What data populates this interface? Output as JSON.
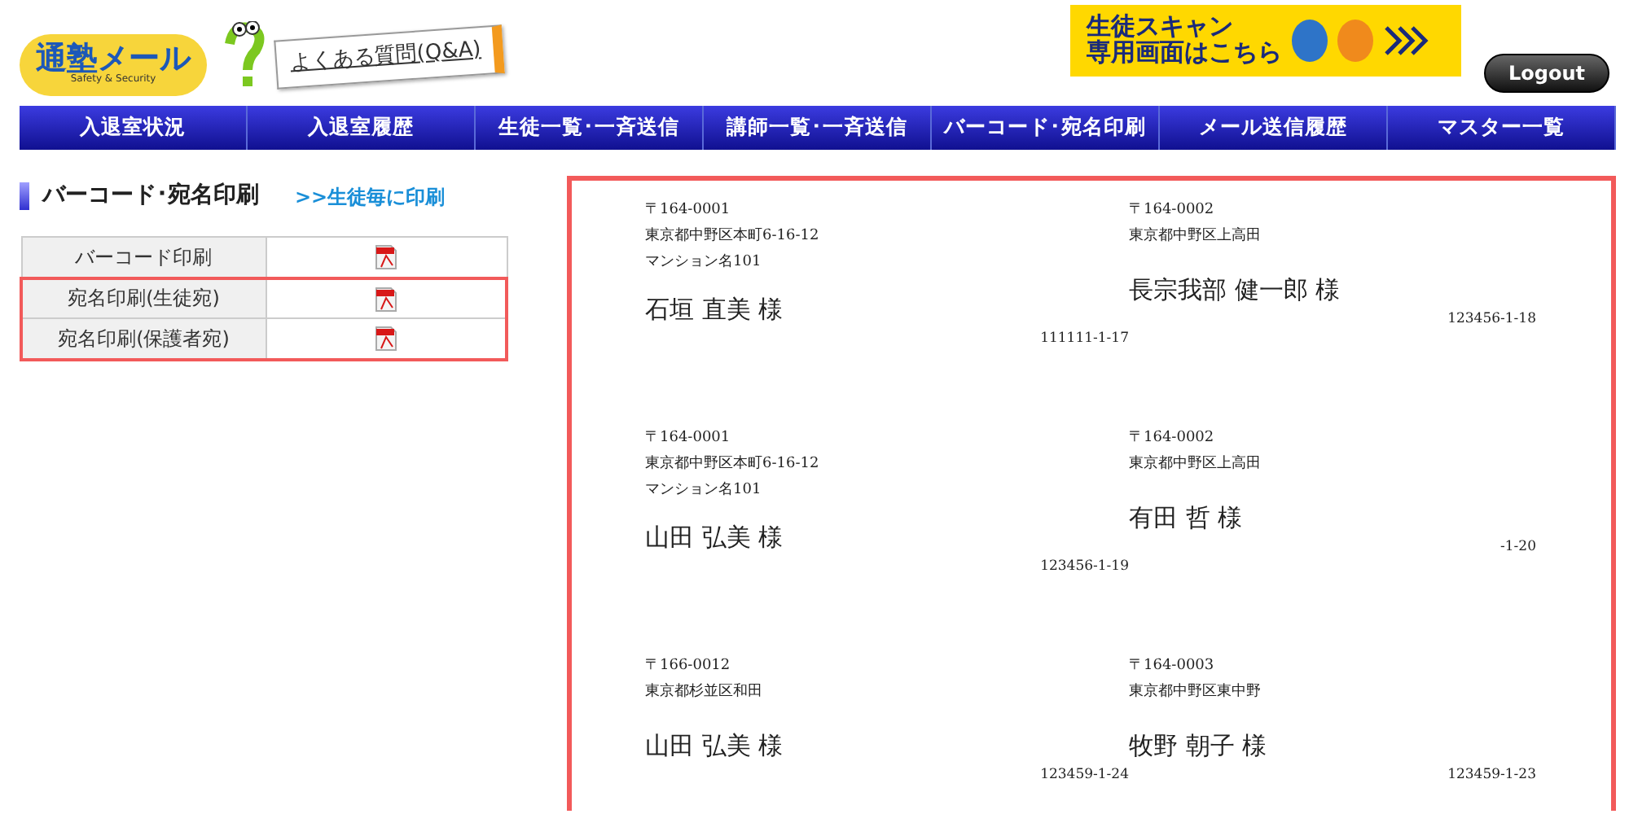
{
  "header": {
    "logo_text": "通塾メール",
    "logo_tagline": "Safety & Security",
    "faq_link": "よくある質問(Q&A)",
    "student_banner": [
      "生徒スキャン",
      "専用画面はこちら"
    ],
    "logout_button": "Logout"
  },
  "nav": [
    {
      "label": "入退室状況",
      "selected": false
    },
    {
      "label": "入退室履歴",
      "selected": false
    },
    {
      "label": "生徒一覧･一斉送信",
      "selected": false
    },
    {
      "label": "講師一覧･一斉送信",
      "selected": false
    },
    {
      "label": "バーコード･宛名印刷",
      "selected": false
    },
    {
      "label": "メール送信履歴",
      "selected": false
    },
    {
      "label": "マスター一覧",
      "selected": false
    }
  ],
  "section": {
    "title": "バーコード･宛名印刷",
    "link": ">>生徒毎に印刷"
  },
  "print_table": [
    {
      "label": "バーコード印刷",
      "highlighted": false
    },
    {
      "label": "宛名印刷(生徒宛)",
      "highlighted": true
    },
    {
      "label": "宛名印刷(保護者宛)",
      "highlighted": true
    }
  ],
  "preview": {
    "highlighted": true,
    "labels": [
      {
        "postal": "〒164-0001",
        "address": [
          "東京都中野区本町6-16-12",
          "マンション名101"
        ],
        "name": "石垣 直美 様",
        "code": "111111-1-17"
      },
      {
        "postal": "〒164-0002",
        "address": [
          "東京都中野区上高田"
        ],
        "name": "長宗我部 健一郎 様",
        "code": "123456-1-18"
      },
      {
        "postal": "〒164-0001",
        "address": [
          "東京都中野区本町6-16-12",
          "マンション名101"
        ],
        "name": "山田 弘美 様",
        "code": "123456-1-19"
      },
      {
        "postal": "〒164-0002",
        "address": [
          "東京都中野区上高田"
        ],
        "name": "有田 哲 様",
        "code": "-1-20"
      },
      {
        "postal": "〒166-0012",
        "address": [
          "東京都杉並区和田"
        ],
        "name": "山田 弘美 様",
        "code": "123459-1-24"
      },
      {
        "postal": "〒164-0003",
        "address": [
          "東京都中野区東中野"
        ],
        "name": "牧野 朝子 様",
        "code": "123459-1-23"
      }
    ]
  }
}
